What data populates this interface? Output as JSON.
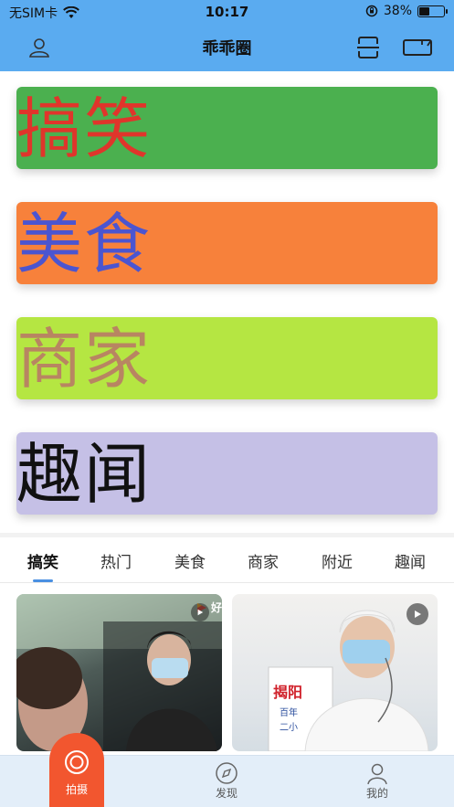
{
  "status_bar": {
    "carrier": "无SIM卡",
    "time": "10:17",
    "battery": "38%",
    "battery_level": 0.38
  },
  "navbar": {
    "title": "乖乖圈",
    "left_icon": "user-icon",
    "right_icons": [
      "scan-icon",
      "video-camera-icon"
    ]
  },
  "banners": [
    {
      "label": "搞笑",
      "bg": "#4bb04f",
      "fg": "#e0352b"
    },
    {
      "label": "美食",
      "bg": "#f7813b",
      "fg": "#4b55d0"
    },
    {
      "label": "商家",
      "bg": "#b5e642",
      "fg": "#b88562"
    },
    {
      "label": "趣闻",
      "bg": "#c5c0e6",
      "fg": "#111111"
    }
  ],
  "tabs": [
    "搞笑",
    "热门",
    "美食",
    "商家",
    "附近",
    "趣闻"
  ],
  "active_tab": "搞笑",
  "accent": "#4a90e2",
  "feed": {
    "card1_brand": "好",
    "card2_texts": [
      "揭阳",
      "百年",
      "二小"
    ]
  },
  "tabbar": {
    "shoot": "拍摄",
    "discover": "发现",
    "mine": "我的",
    "shoot_color": "#f2562f"
  }
}
